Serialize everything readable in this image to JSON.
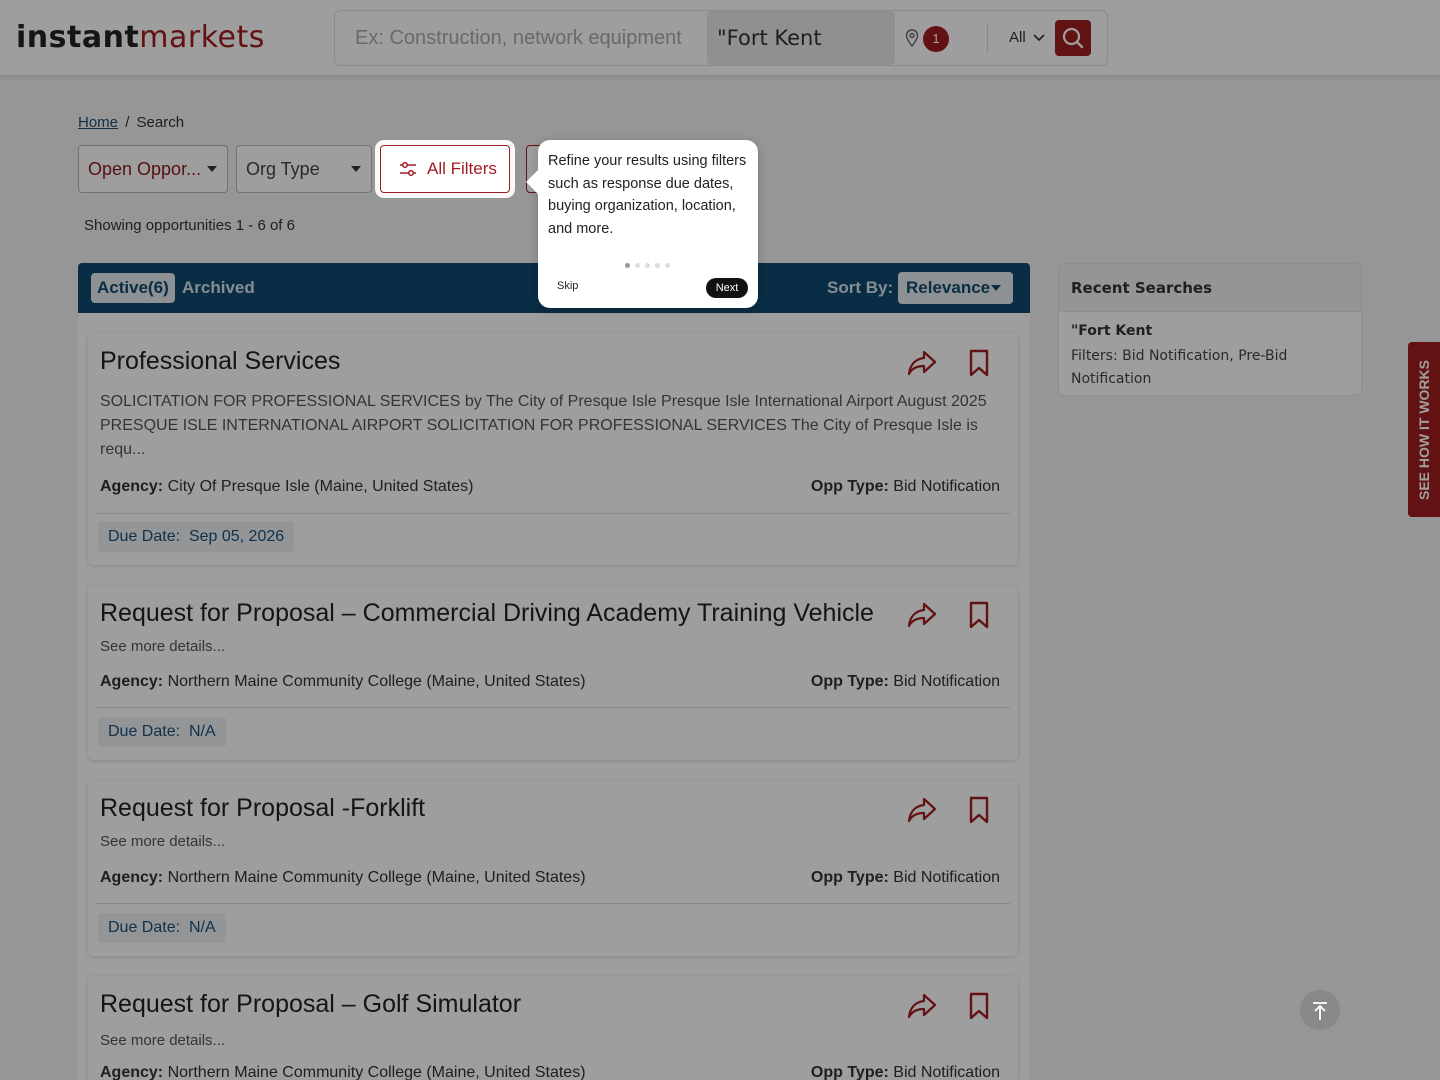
{
  "header": {
    "logo_part1": "instant",
    "logo_part2": "markets",
    "search_placeholder": "Ex: Construction, network equipment",
    "location_value": "\"Fort Kent",
    "location_count": "1",
    "scope_label": "All"
  },
  "breadcrumb": {
    "home": "Home",
    "sep": "/",
    "current": "Search"
  },
  "filters": {
    "status_label": "Open Oppor...",
    "org_type_label": "Org Type",
    "all_filters_label": "All Filters"
  },
  "results_summary": "Showing opportunities 1 - 6 of 6",
  "tabs": {
    "active": "Active(6)",
    "archived": "Archived",
    "sort_label": "Sort By:",
    "sort_value": "Relevance"
  },
  "opportunities": [
    {
      "title": "Professional Services",
      "description": "SOLICITATION FOR PROFESSIONAL SERVICES by The City of Presque Isle Presque Isle International Airport August 2025 PRESQUE ISLE INTERNATIONAL AIRPORT SOLICITATION FOR PROFESSIONAL SERVICES The City of Presque Isle is requ...",
      "agency_label": "Agency:",
      "agency": "City Of Presque Isle (Maine, United States)",
      "opp_type_label": "Opp Type:",
      "opp_type": "Bid Notification",
      "due_label": "Due Date:",
      "due": "Sep 05, 2026"
    },
    {
      "title": "Request for Proposal – Commercial Driving Academy Training Vehicle",
      "description": "See more details...",
      "agency_label": "Agency:",
      "agency": "Northern Maine Community College (Maine, United States)",
      "opp_type_label": "Opp Type:",
      "opp_type": "Bid Notification",
      "due_label": "Due Date:",
      "due": "N/A"
    },
    {
      "title": "Request for Proposal -Forklift",
      "description": "See more details...",
      "agency_label": "Agency:",
      "agency": "Northern Maine Community College (Maine, United States)",
      "opp_type_label": "Opp Type:",
      "opp_type": "Bid Notification",
      "due_label": "Due Date:",
      "due": "N/A"
    },
    {
      "title": "Request for Proposal – Golf Simulator",
      "description": "See more details...",
      "agency_label": "Agency:",
      "agency": "Northern Maine Community College (Maine, United States)",
      "opp_type_label": "Opp Type:",
      "opp_type": "Bid Notification"
    }
  ],
  "recent_searches": {
    "title": "Recent Searches",
    "item_title": "\"Fort Kent",
    "item_filters": "Filters: Bid Notification, Pre-Bid Notification"
  },
  "side_tab_label": "SEE HOW IT WORKS",
  "tour": {
    "text": "Refine your results using filters such as response due dates, buying organization, location, and more.",
    "skip": "Skip",
    "next": "Next",
    "step": 1,
    "total_steps": 5
  },
  "colors": {
    "brand_red": "#a11d21",
    "navy": "#0f4a6e"
  }
}
